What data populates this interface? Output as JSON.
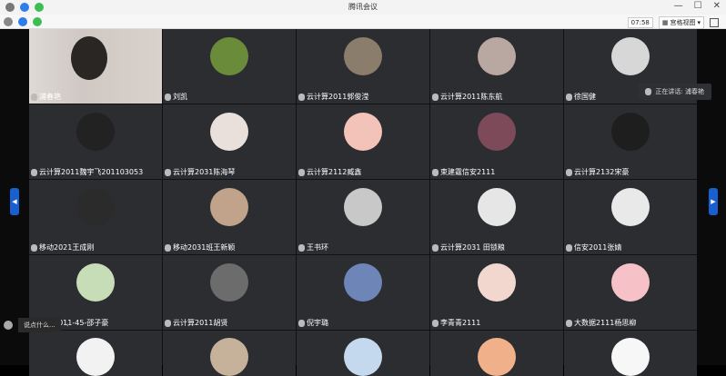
{
  "window": {
    "title": "腾讯会议"
  },
  "toolbar": {
    "time": "07:58",
    "view_label": "宫格视图"
  },
  "speaking": {
    "label": "正在讲话: 浦春艳"
  },
  "chat": {
    "placeholder": "说点什么..."
  },
  "tiles": [
    {
      "name": "浦春艳"
    },
    {
      "name": "刘凯"
    },
    {
      "name": "云计算2011郭俊滢"
    },
    {
      "name": "云计算2011陈东航"
    },
    {
      "name": "徐国健"
    },
    {
      "name": "云计算2011魏宇飞201103053"
    },
    {
      "name": "云计算2031陈海琴"
    },
    {
      "name": "云计算2112臧鑫"
    },
    {
      "name": "束建霆信安2111"
    },
    {
      "name": "云计算2132宋豪"
    },
    {
      "name": "移动2021王成刚"
    },
    {
      "name": "移动2031班王新颖"
    },
    {
      "name": "王书环"
    },
    {
      "name": "云计算2031 田锁粮"
    },
    {
      "name": "信安2011张婧"
    },
    {
      "name": "信安2011-45-邵子豪"
    },
    {
      "name": "云计算2011胡贤"
    },
    {
      "name": "倪宇璐"
    },
    {
      "name": "李青青2111"
    },
    {
      "name": "大数据2111杨思柳"
    },
    {
      "name": ""
    },
    {
      "name": ""
    },
    {
      "name": ""
    },
    {
      "name": ""
    },
    {
      "name": ""
    }
  ]
}
